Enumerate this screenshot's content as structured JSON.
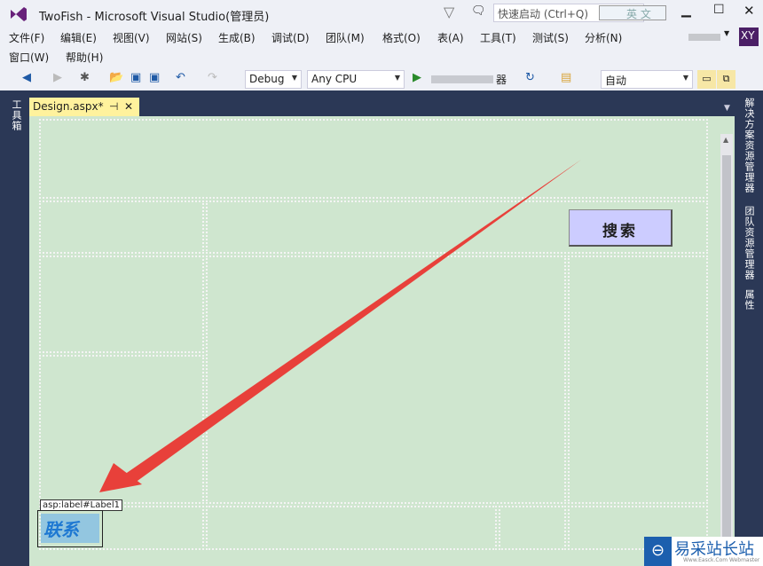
{
  "title": "TwoFish - Microsoft Visual Studio(管理员)",
  "quick_launch": {
    "placeholder": "快速启动 (Ctrl+Q)",
    "ime": "英 文"
  },
  "user_initials": "XY",
  "menu": [
    "文件(F)",
    "编辑(E)",
    "视图(V)",
    "网站(S)",
    "生成(B)",
    "调试(D)",
    "团队(M)",
    "格式(O)",
    "表(A)",
    "工具(T)",
    "测试(S)",
    "分析(N)",
    "窗口(W)",
    "帮助(H)"
  ],
  "toolbar": {
    "config": "Debug",
    "platform": "Any CPU",
    "run_suffix": "器",
    "block_format": "自动"
  },
  "left_dock": "工具箱",
  "tab": {
    "label": "Design.aspx*",
    "pin": "⊣",
    "close": "✕"
  },
  "right_dock": [
    "解决方案资源管理器",
    "团队资源管理器",
    "属性"
  ],
  "design": {
    "search_button": "搜索",
    "label_tag": "asp:label#Label1",
    "label_text": "联系"
  },
  "watermark": {
    "name": "易采站长站",
    "sub": "Www.Easck.Com Webmaster"
  },
  "colors": {
    "surface": "#cfe6cf",
    "dock": "#2b3856",
    "arrow": "#e8403a"
  }
}
